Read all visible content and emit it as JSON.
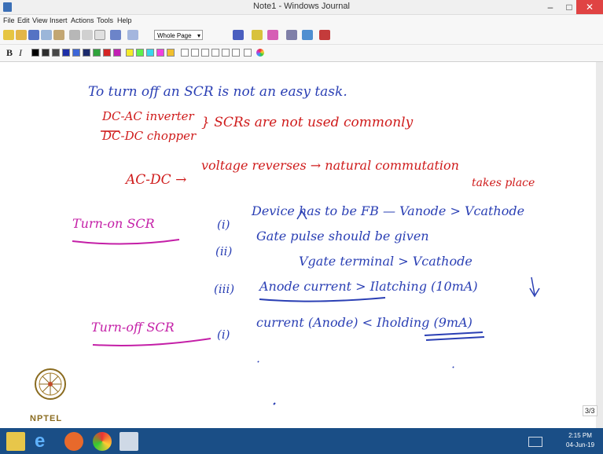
{
  "window": {
    "title": "Note1 - Windows Journal",
    "min": "–",
    "max": "□",
    "close": "✕"
  },
  "menu": [
    "File",
    "Edit",
    "View",
    "Insert",
    "Actions",
    "Tools",
    "Help"
  ],
  "toolbar": {
    "zoom_value": "Whole Page"
  },
  "notes": {
    "line1": "To turn off an SCR is not an easy task.",
    "line2a": "DC-AC inverter",
    "line2b": "DC-DC chopper",
    "line2c": "} SCRs are not used commonly",
    "line3a": "AC-DC →",
    "line3b": "voltage reverses → natural commutation",
    "line3c": "takes place",
    "turn_on": "Turn-on SCR",
    "i1": "(i)",
    "c1": "Device has to be FB — Vanode > Vcathode",
    "i2": "(ii)",
    "c2": "Gate pulse should be given",
    "c2b": "Vgate terminal > Vcathode",
    "i3": "(iii)",
    "c3": "Anode current > Ilatching (10mA)",
    "turn_off": "Turn-off SCR",
    "i4": "(i)",
    "c4": "current (Anode) < Iholding (9mA)"
  },
  "page_indicator": "3/3",
  "logo_text": "NPTEL",
  "clock": {
    "time": "2:15 PM",
    "date": "04-Jun-19"
  },
  "colors": {
    "ink_blue": "#2a3fb4",
    "ink_red": "#cf1b1b",
    "ink_magenta": "#c41fa7",
    "taskbar": "#1a4e86"
  }
}
